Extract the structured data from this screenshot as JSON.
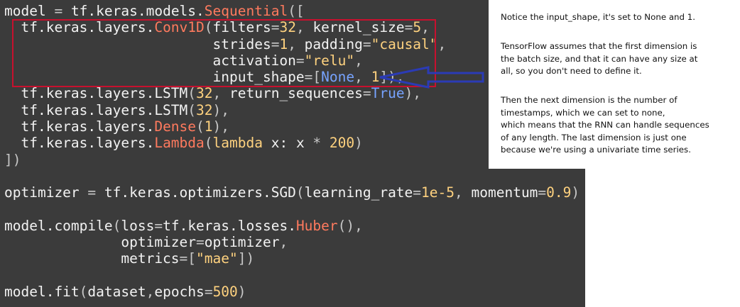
{
  "code_lines": [
    [
      [
        "model ",
        "plain"
      ],
      [
        "= ",
        "op"
      ],
      [
        "tf.keras.models.",
        "plain"
      ],
      [
        "Sequential",
        "class"
      ],
      [
        "([",
        "op"
      ]
    ],
    [
      [
        "  tf.keras.layers.",
        "plain"
      ],
      [
        "Conv1D",
        "class"
      ],
      [
        "(",
        "op"
      ],
      [
        "filters",
        "plain"
      ],
      [
        "=",
        "op"
      ],
      [
        "32",
        "num"
      ],
      [
        ", ",
        "op"
      ],
      [
        "kernel_size",
        "plain"
      ],
      [
        "=",
        "op"
      ],
      [
        "5",
        "num"
      ],
      [
        ",",
        "op"
      ]
    ],
    [
      [
        "                         strides",
        "plain"
      ],
      [
        "=",
        "op"
      ],
      [
        "1",
        "num"
      ],
      [
        ", ",
        "op"
      ],
      [
        "padding",
        "plain"
      ],
      [
        "=",
        "op"
      ],
      [
        "\"causal\"",
        "str"
      ],
      [
        ",",
        "op"
      ]
    ],
    [
      [
        "                         activation",
        "plain"
      ],
      [
        "=",
        "op"
      ],
      [
        "\"relu\"",
        "str"
      ],
      [
        ",",
        "op"
      ]
    ],
    [
      [
        "                         input_shape",
        "plain"
      ],
      [
        "=[",
        "op"
      ],
      [
        "None",
        "const"
      ],
      [
        ", ",
        "op"
      ],
      [
        "1",
        "num"
      ],
      [
        "]),",
        "op"
      ]
    ],
    [
      [
        "  tf.keras.layers.LSTM",
        "plain"
      ],
      [
        "(",
        "op"
      ],
      [
        "32",
        "num"
      ],
      [
        ", ",
        "op"
      ],
      [
        "return_sequences",
        "plain"
      ],
      [
        "=",
        "op"
      ],
      [
        "True",
        "const"
      ],
      [
        "),",
        "op"
      ]
    ],
    [
      [
        "  tf.keras.layers.LSTM",
        "plain"
      ],
      [
        "(",
        "op"
      ],
      [
        "32",
        "num"
      ],
      [
        "),",
        "op"
      ]
    ],
    [
      [
        "  tf.keras.layers.",
        "plain"
      ],
      [
        "Dense",
        "class"
      ],
      [
        "(",
        "op"
      ],
      [
        "1",
        "num"
      ],
      [
        "),",
        "op"
      ]
    ],
    [
      [
        "  tf.keras.layers.",
        "plain"
      ],
      [
        "Lambda",
        "class"
      ],
      [
        "(",
        "op"
      ],
      [
        "lambda ",
        "kw"
      ],
      [
        "x: x ",
        "plain"
      ],
      [
        "* ",
        "op"
      ],
      [
        "200",
        "num"
      ],
      [
        ")",
        "op"
      ]
    ],
    [
      [
        "])",
        "op"
      ]
    ],
    [
      [
        "",
        "plain"
      ]
    ],
    [
      [
        "optimizer ",
        "plain"
      ],
      [
        "= ",
        "op"
      ],
      [
        "tf.keras.optimizers.SGD",
        "plain"
      ],
      [
        "(",
        "op"
      ],
      [
        "learning_rate",
        "plain"
      ],
      [
        "=",
        "op"
      ],
      [
        "1e-5",
        "num"
      ],
      [
        ", ",
        "op"
      ],
      [
        "momentum",
        "plain"
      ],
      [
        "=",
        "op"
      ],
      [
        "0.9",
        "num"
      ],
      [
        ")",
        "op"
      ]
    ],
    [
      [
        "",
        "plain"
      ]
    ],
    [
      [
        "model.compile",
        "plain"
      ],
      [
        "(",
        "op"
      ],
      [
        "loss",
        "plain"
      ],
      [
        "=",
        "op"
      ],
      [
        "tf.keras.losses.",
        "plain"
      ],
      [
        "Huber",
        "class"
      ],
      [
        "(),",
        "op"
      ]
    ],
    [
      [
        "              optimizer",
        "plain"
      ],
      [
        "=",
        "op"
      ],
      [
        "optimizer",
        "plain"
      ],
      [
        ",",
        "op"
      ]
    ],
    [
      [
        "              metrics",
        "plain"
      ],
      [
        "=[",
        "op"
      ],
      [
        "\"mae\"",
        "str"
      ],
      [
        "])",
        "op"
      ]
    ],
    [
      [
        "",
        "plain"
      ]
    ],
    [
      [
        "model.fit",
        "plain"
      ],
      [
        "(",
        "op"
      ],
      [
        "dataset",
        "plain"
      ],
      [
        ",",
        "op"
      ],
      [
        "epochs",
        "plain"
      ],
      [
        "=",
        "op"
      ],
      [
        "500",
        "num"
      ],
      [
        ")",
        "op"
      ]
    ]
  ],
  "note": {
    "paragraphs": [
      [
        "Notice the input_shape, it's set to None and 1."
      ],
      [
        "TensorFlow assumes that the first dimension is",
        "the batch size, and that it can have any size at",
        "all, so you don't need to define it."
      ],
      [
        "Then the next dimension is the number of",
        "timestamps, which we can set to none,",
        "which means that the RNN can handle sequences",
        "of any length. The last dimension is just one",
        "because we're using a univariate time series."
      ]
    ]
  },
  "colors": {
    "code_background": "#3b3b3b",
    "highlight_box": "#c8102e",
    "arrow": "#2b3bb5"
  }
}
